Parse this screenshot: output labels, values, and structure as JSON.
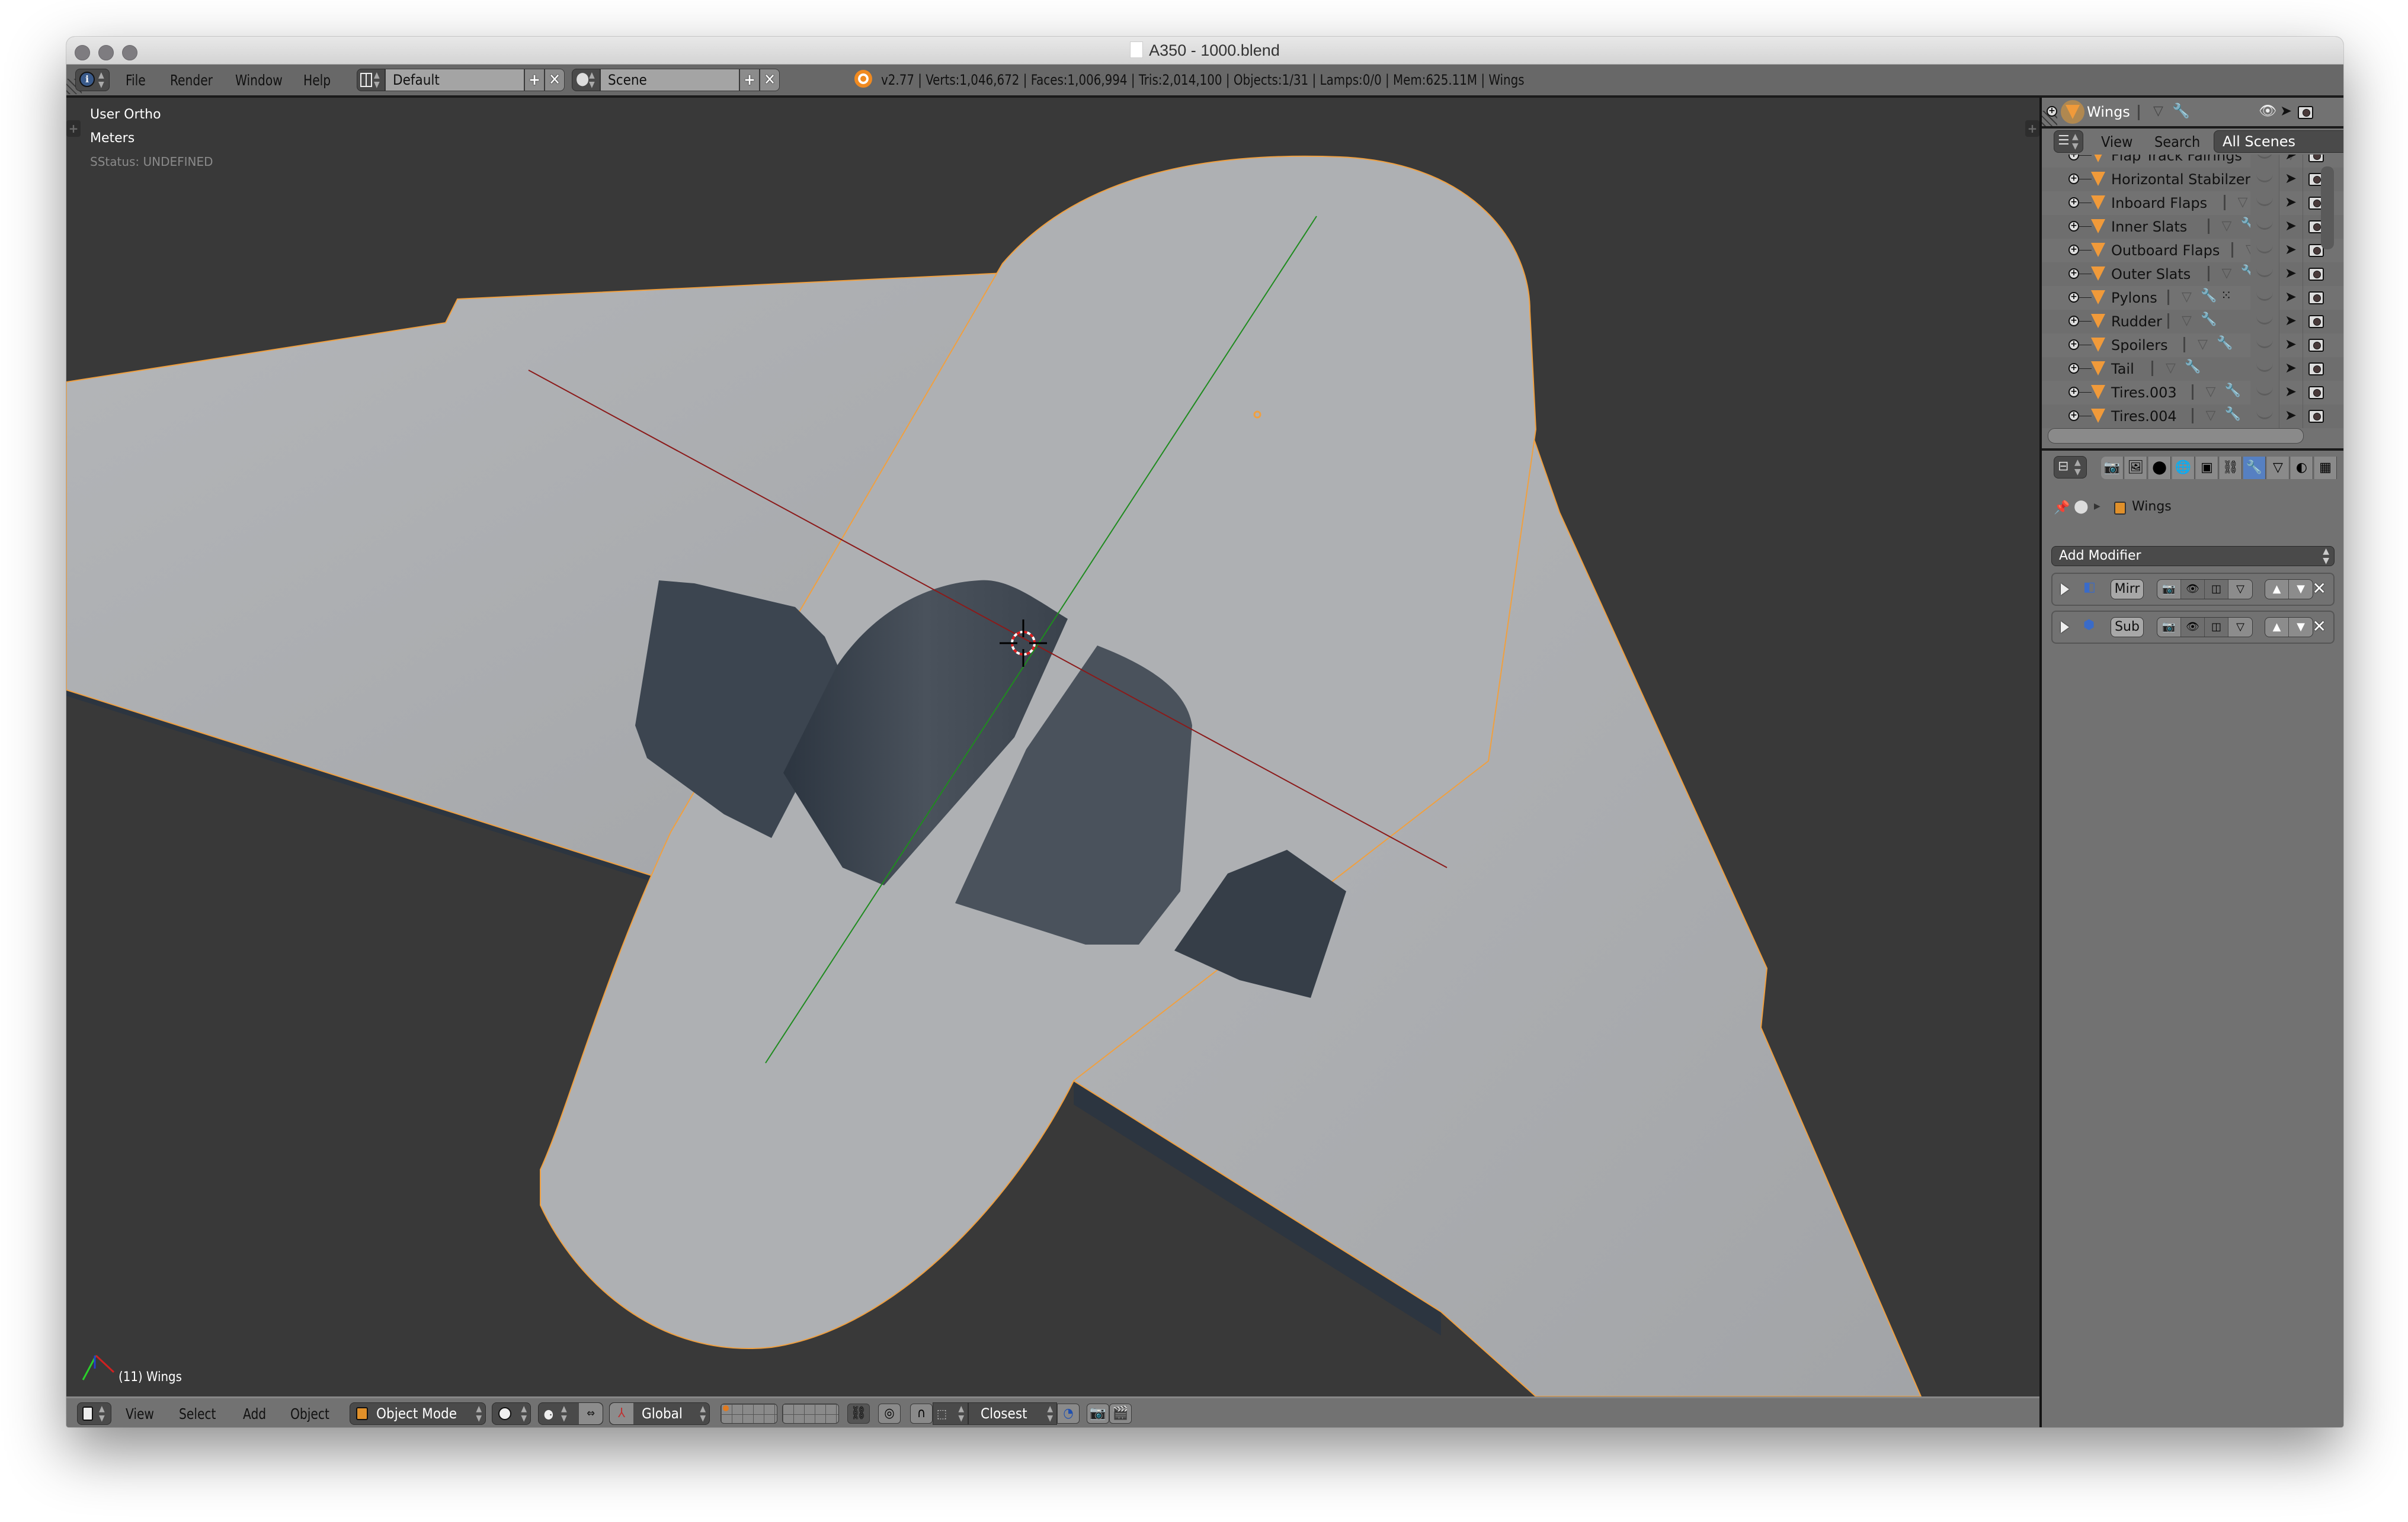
{
  "window": {
    "title": "A350 - 1000.blend",
    "traffic_lights": [
      "close",
      "minimize",
      "zoom"
    ]
  },
  "top_header": {
    "editor_type_icon": "info-icon",
    "menus": [
      "File",
      "Render",
      "Window",
      "Help"
    ],
    "screen_layout": {
      "icon": "screen-layout-icon",
      "value": "Default"
    },
    "scene": {
      "icon": "scene-icon",
      "value": "Scene"
    },
    "stats": "v2.77 | Verts:1,046,672 | Faces:1,006,994 | Tris:2,014,100 | Objects:1/31 | Lamps:0/0 | Mem:625.11M | Wings"
  },
  "viewport": {
    "view_name": "User Ortho",
    "units": "Meters",
    "status": "SStatus: UNDEFINED",
    "active_object": "(11) Wings",
    "colors": {
      "background": "#393939",
      "mesh": "#a9abae",
      "cavity": "#3c4550",
      "selection_outline": "#f0a040",
      "x_axis": "#8b1a1a",
      "y_axis": "#1f8b1f"
    }
  },
  "bottom_header": {
    "editor_type_icon": "3d-view-icon",
    "menus": [
      "View",
      "Select",
      "Add",
      "Object"
    ],
    "mode": "Object Mode",
    "orientation": "Global",
    "snap_target": "Closest"
  },
  "outliner": {
    "active": {
      "name": "Wings"
    },
    "toolbar": {
      "menus": [
        "View",
        "Search"
      ],
      "display_mode": "All Scenes"
    },
    "items": [
      {
        "name": "Flap Track Fairings",
        "partial": true,
        "modifier": true
      },
      {
        "name": "Horizontal Stabilzers",
        "modifier": false,
        "mesh_data": false
      },
      {
        "name": "Inboard Flaps",
        "modifier": true
      },
      {
        "name": "Inner Slats",
        "modifier": true
      },
      {
        "name": "Outboard Flaps",
        "modifier": false
      },
      {
        "name": "Outer Slats",
        "modifier": true
      },
      {
        "name": "Pylons",
        "modifier": true,
        "particles": true
      },
      {
        "name": "Rudder",
        "modifier": true
      },
      {
        "name": "Spoilers",
        "modifier": true
      },
      {
        "name": "Tail",
        "modifier": true
      },
      {
        "name": "Tires.003",
        "modifier": true
      },
      {
        "name": "Tires.004",
        "partial": true,
        "modifier": true
      }
    ]
  },
  "properties": {
    "tabs": [
      "render",
      "render-layers",
      "scene",
      "world",
      "object",
      "constraints",
      "modifiers",
      "data",
      "material",
      "texture"
    ],
    "active_tab": "modifiers",
    "breadcrumb": "Wings",
    "add_modifier_label": "Add Modifier",
    "modifiers": [
      {
        "short_name": "Mirr",
        "type": "mirror"
      },
      {
        "short_name": "Sub",
        "type": "subdivision-surface"
      }
    ]
  }
}
